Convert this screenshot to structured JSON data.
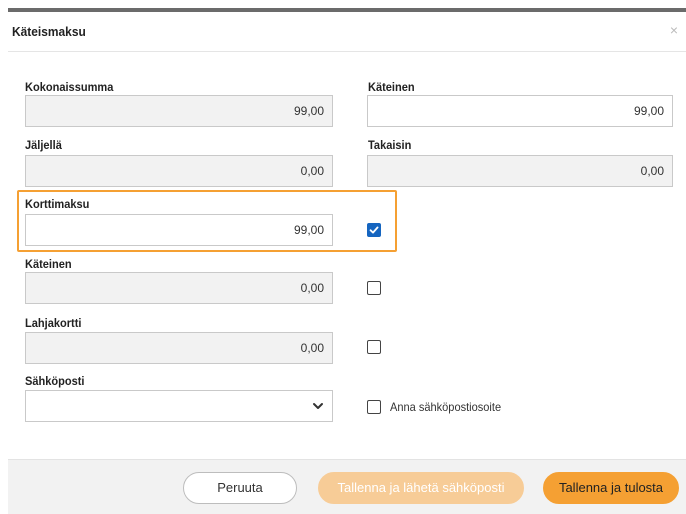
{
  "dialog": {
    "title": "Käteismaksu",
    "close_symbol": "×"
  },
  "form": {
    "total_label": "Kokonaissumma",
    "total_value": "99,00",
    "cash_top_label": "Käteinen",
    "cash_top_value": "99,00",
    "remaining_label": "Jäljellä",
    "remaining_value": "0,00",
    "change_label": "Takaisin",
    "change_value": "0,00",
    "card_label": "Korttimaksu",
    "card_value": "99,00",
    "card_checked": true,
    "cash_label": "Käteinen",
    "cash_value": "0,00",
    "cash_checked": false,
    "giftcard_label": "Lahjakortti",
    "giftcard_value": "0,00",
    "giftcard_checked": false,
    "email_label": "Sähköposti",
    "email_selected": "",
    "email_checkbox_label": "Anna sähköpostiosoite",
    "email_checked": false
  },
  "footer": {
    "cancel_label": "Peruuta",
    "save_email_label": "Tallenna ja lähetä sähköposti",
    "save_print_label": "Tallenna ja tulosta"
  },
  "colors": {
    "accent": "#f5a033",
    "accent_disabled": "#f7cc97",
    "checkbox_checked": "#1565c0"
  }
}
